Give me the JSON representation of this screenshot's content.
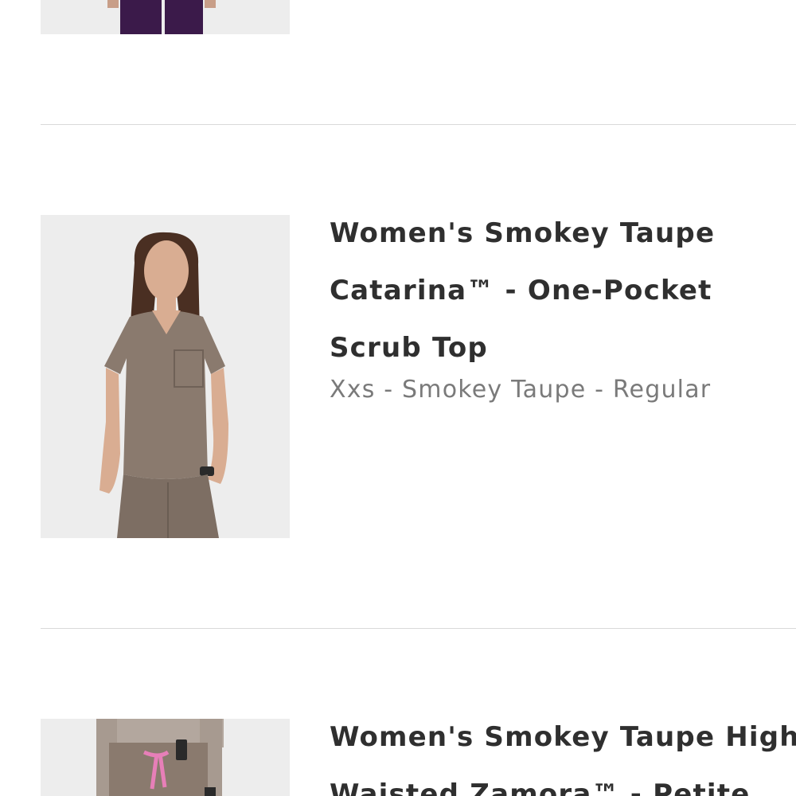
{
  "cart_items": [
    {
      "title_lines": [],
      "variant": "",
      "image_alt": "purple scrub pants"
    },
    {
      "title_lines": [
        "Women's Smokey Taupe",
        "Catarina™ - One-Pocket",
        "Scrub Top"
      ],
      "variant": "Xxs - Smokey Taupe - Regular",
      "image_alt": "woman wearing smokey taupe scrub top"
    },
    {
      "title_lines": [
        "Women's Smokey Taupe High",
        "Waisted Zamora™ - Petite"
      ],
      "variant": "",
      "image_alt": "smokey taupe scrub pants with pink drawstring"
    }
  ],
  "colors": {
    "title": "#2f2f2f",
    "variant": "#7a7a7a",
    "divider": "#d9d9d9",
    "image_bg": "#ededed",
    "taupe": "#8a7a6e",
    "plum": "#3b1a4a",
    "pink": "#e77fb8"
  }
}
